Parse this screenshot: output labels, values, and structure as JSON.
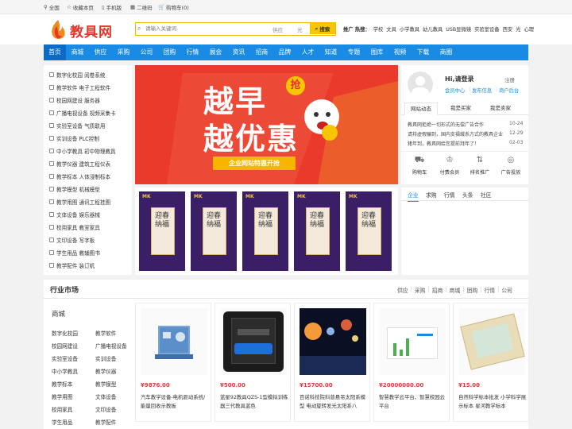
{
  "topbar": {
    "nationwide": "全国",
    "favorite": "收藏本页",
    "mobile": "手机版",
    "qrcode": "二维码",
    "cart": "购物车(0)"
  },
  "logo": {
    "text": "教具网"
  },
  "search": {
    "placeholder": "请输入关键词",
    "type1": "供应",
    "type2": "光",
    "button": "搜索"
  },
  "hot": {
    "label": "推广 热搜：",
    "items": [
      "学校",
      "文具",
      "小学教具",
      "幼儿教具",
      "USB显微镜",
      "实验室设备",
      "西安",
      "光",
      "心理"
    ]
  },
  "nav": [
    "首页",
    "商城",
    "供应",
    "采购",
    "公司",
    "团购",
    "行情",
    "展会",
    "资讯",
    "招商",
    "品牌",
    "人才",
    "知道",
    "专题",
    "图库",
    "视频",
    "下载",
    "商圈"
  ],
  "leftmenu": [
    "数字化校园 阅卷系统",
    "教学软件 电子工程软件",
    "校园网建设 服务器",
    "广播电视设备 视频采集卡",
    "实验室设备 气质联用",
    "实训设备 PLC控制",
    "中小学教具 初中物理教具",
    "教学仪器 建筑工程仪表",
    "教学标本 人体浸制标本",
    "教学模型 机械模型",
    "教学用图 通讯工程挂图",
    "文体设备 娱乐器械",
    "校用家具 教室家具",
    "文印设备 写字板",
    "学生用品 教辅图书",
    "教学配件 装订机"
  ],
  "banner": {
    "line1": "越早",
    "line2": "越优惠",
    "badge": "抢",
    "cta": "企业网站特惠开抢"
  },
  "thumbs": {
    "logo": "MK",
    "text": "迎春纳福"
  },
  "user": {
    "greeting": "Hi,请登录",
    "register": "注册",
    "center": "会员中心",
    "post": "发布信息",
    "backend": "商户后台",
    "tabs": [
      "网站动态",
      "我是买家",
      "我是卖家"
    ],
    "news": [
      {
        "t": "教具网拒绝一切形式的无偿广告合作",
        "d": "10-24"
      },
      {
        "t": "请持虚假骗到，国内支福蛾系方式的教具企业",
        "d": "12-29"
      },
      {
        "t": "猪年到，教具网给您提前拜年了！",
        "d": "02-03"
      }
    ],
    "shortcuts": [
      "购物车",
      "付费会员",
      "排名推广",
      "广告投放"
    ]
  },
  "rp2": {
    "tabs": [
      "企业",
      "求购",
      "行情",
      "头条",
      "社区"
    ]
  },
  "market": {
    "title": "行业市场",
    "links": [
      "供应",
      "采购",
      "招商",
      "商城",
      "团购",
      "行情",
      "公司"
    ],
    "sub": "商城",
    "cats": [
      [
        "数字化校园",
        "教学软件"
      ],
      [
        "校园网建设",
        "广播电视设备"
      ],
      [
        "实验室设备",
        "实训设备"
      ],
      [
        "中小学教具",
        "教学仪器"
      ],
      [
        "教学标本",
        "教学模型"
      ],
      [
        "教学用图",
        "文体设备"
      ],
      [
        "校用家具",
        "文印设备"
      ],
      [
        "学生用品",
        "教学配件"
      ]
    ]
  },
  "products": [
    {
      "price": "¥9876.00",
      "name": "汽车教学设备-电机驱动系统/能量回收示教板"
    },
    {
      "price": "¥500.00",
      "name": "蓝星92教具QZS-1型模拟训练器三代教具蓝色"
    },
    {
      "price": "¥15700.00",
      "name": "百诺科技院科普悬吊太阳系模型 电动旋转发光太阳系八"
    },
    {
      "price": "¥20000000.00",
      "name": "智慧教学云平台、智慧校园云平台"
    },
    {
      "price": "¥15.00",
      "name": "自然科学标本批发 小学科学展示标本 星河教学标本"
    }
  ],
  "colors": {
    "nav": "#1a8be5",
    "price": "#e4393c",
    "accent": "#f7c600"
  }
}
